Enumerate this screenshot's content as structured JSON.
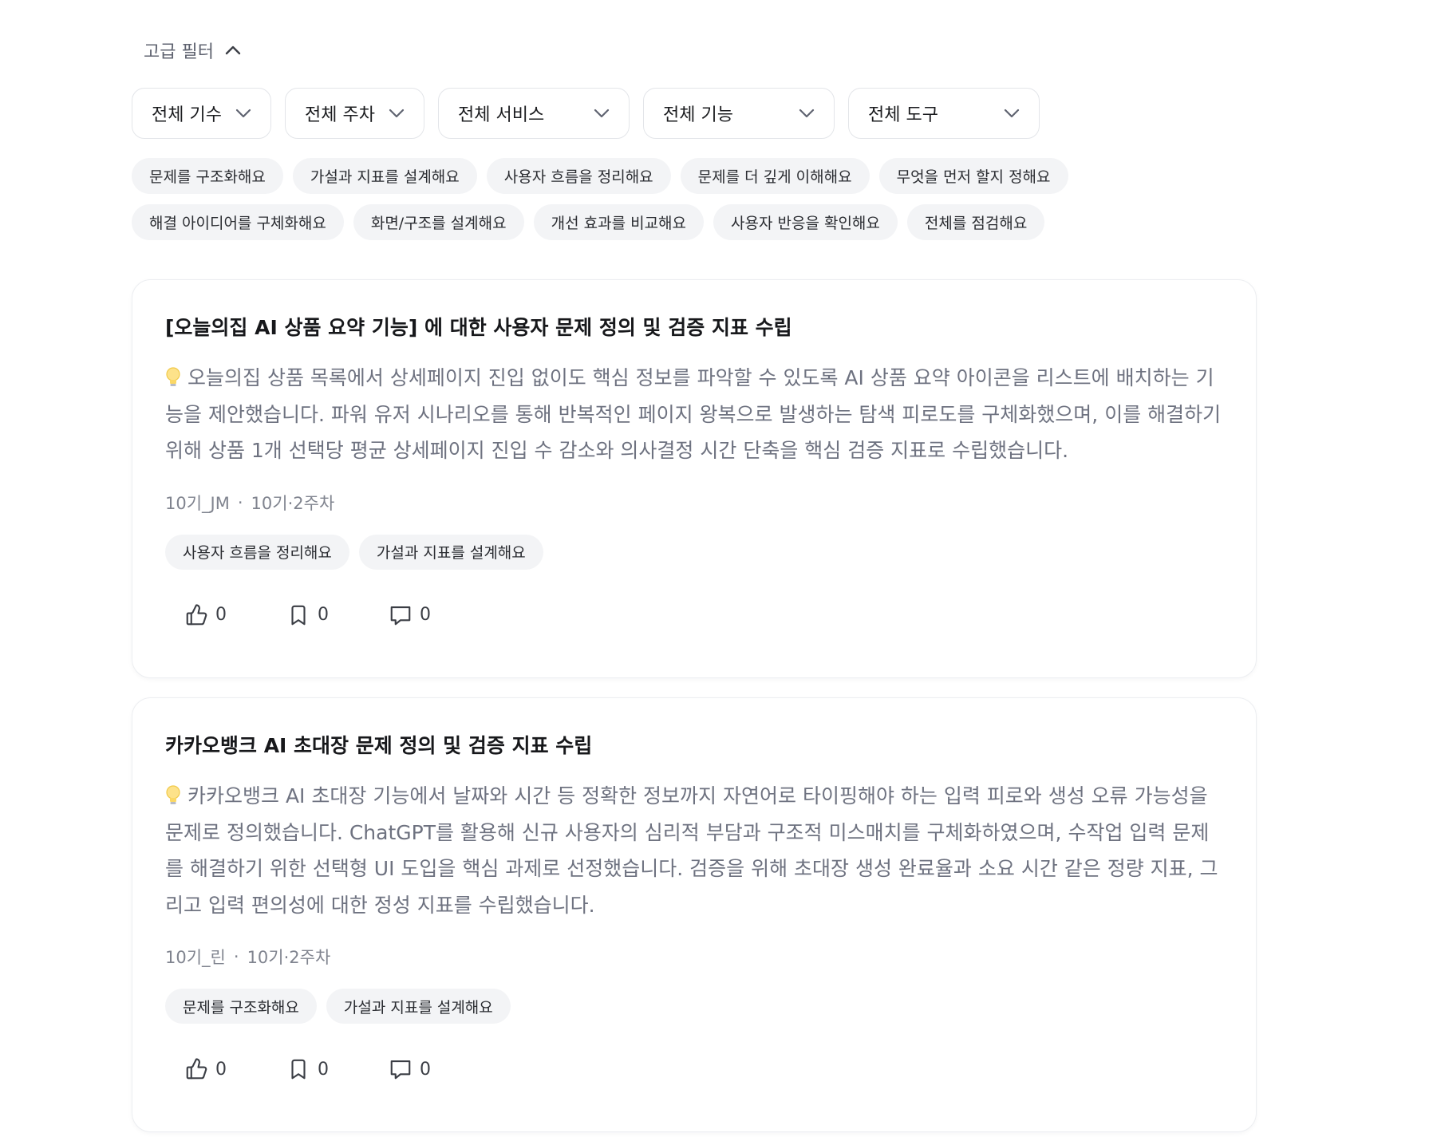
{
  "advanced_filter": {
    "label": "고급 필터",
    "icon": "chevron-up-icon"
  },
  "dropdowns": [
    {
      "label": "전체 기수",
      "icon": "chevron-down-icon"
    },
    {
      "label": "전체 주차",
      "icon": "chevron-down-icon"
    },
    {
      "label": "전체 서비스",
      "icon": "chevron-down-icon"
    },
    {
      "label": "전체 기능",
      "icon": "chevron-down-icon"
    },
    {
      "label": "전체 도구",
      "icon": "chevron-down-icon"
    }
  ],
  "tag_filters": {
    "row1": [
      "문제를 구조화해요",
      "가설과 지표를 설계해요",
      "사용자 흐름을 정리해요",
      "문제를 더 깊게 이해해요",
      "무엇을 먼저 할지 정해요"
    ],
    "row2": [
      "해결 아이디어를 구체화해요",
      "화면/구조를 설계해요",
      "개선 효과를 비교해요",
      "사용자 반응을 확인해요",
      "전체를 점검해요"
    ]
  },
  "posts": [
    {
      "title": "[오늘의집 AI 상품 요약 기능] 에 대한 사용자 문제 정의 및 검증 지표 수립",
      "summary": "오늘의집 상품 목록에서 상세페이지 진입 없이도 핵심 정보를 파악할 수 있도록 AI 상품 요약 아이콘을 리스트에 배치하는 기능을 제안했습니다. 파워 유저 시나리오를 통해 반복적인 페이지 왕복으로 발생하는 탐색 피로도를 구체화했으며, 이를 해결하기 위해 상품 1개 선택당 평균 상세페이지 진입 수 감소와 의사결정 시간 단축을 핵심 검증 지표로 수립했습니다.",
      "summary_icon": "lightbulb-icon",
      "author": "10기_JM",
      "separator": "·",
      "week": "10기·2주차",
      "tags": [
        "사용자 흐름을 정리해요",
        "가설과 지표를 설계해요"
      ],
      "likes": "0",
      "bookmarks": "0",
      "comments": "0"
    },
    {
      "title": "카카오뱅크 AI 초대장 문제 정의 및 검증 지표 수립",
      "summary": "카카오뱅크 AI 초대장 기능에서 날짜와 시간 등 정확한 정보까지 자연어로 타이핑해야 하는 입력 피로와 생성 오류 가능성을 문제로 정의했습니다. ChatGPT를 활용해 신규 사용자의 심리적 부담과 구조적 미스매치를 구체화하였으며, 수작업 입력 문제를 해결하기 위한 선택형 UI 도입을 핵심 과제로 선정했습니다. 검증을 위해 초대장 생성 완료율과 소요 시간 같은 정량 지표, 그리고 입력 편의성에 대한 정성 지표를 수립했습니다.",
      "summary_icon": "lightbulb-icon",
      "author": "10기_린",
      "separator": "·",
      "week": "10기·2주차",
      "tags": [
        "문제를 구조화해요",
        "가설과 지표를 설계해요"
      ],
      "likes": "0",
      "bookmarks": "0",
      "comments": "0"
    }
  ]
}
